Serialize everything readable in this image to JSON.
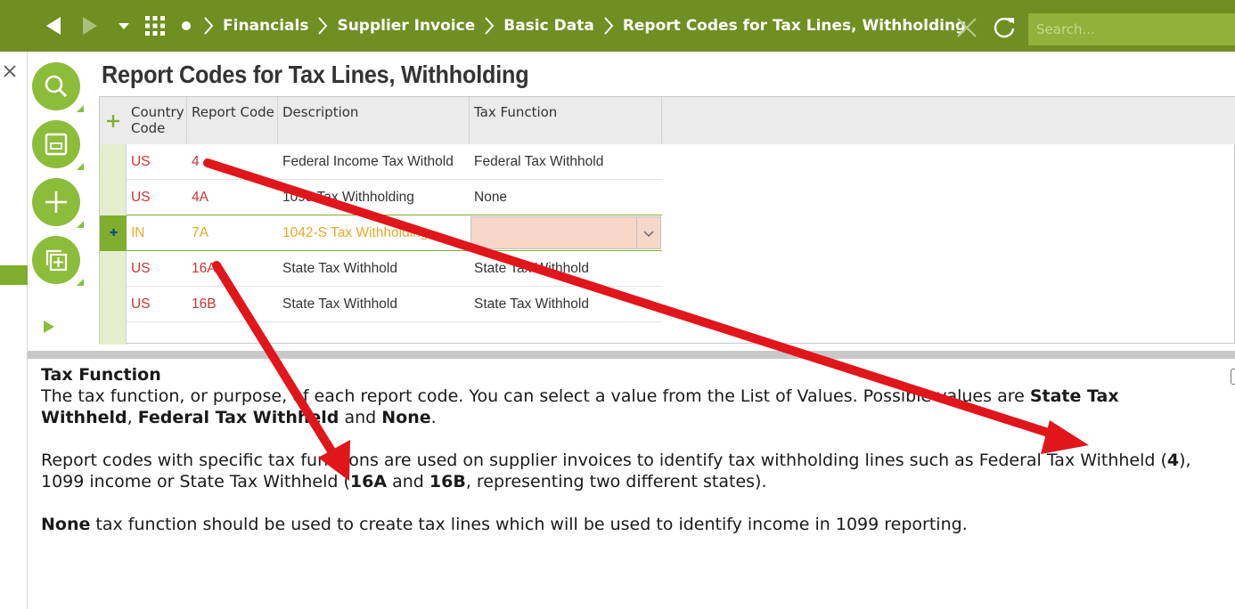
{
  "topbar": {
    "back_icon": "back-arrow-icon",
    "forward_icon": "forward-arrow-icon",
    "dropdown_icon": "history-dropdown-icon",
    "apps_icon": "apps-grid-icon",
    "home_icon": "home-dot-icon",
    "breadcrumbs": [
      "Financials",
      "Supplier Invoice",
      "Basic Data",
      "Report Codes for Tax Lines, Withholding"
    ],
    "search_placeholder": "Search..."
  },
  "page": {
    "title": "Report Codes for Tax Lines, Withholding"
  },
  "grid": {
    "columns": [
      "Country Code",
      "Report Code",
      "Description",
      "Tax Function"
    ],
    "column_lines": [
      [
        "Country",
        "Code"
      ],
      [
        "Report Code"
      ],
      [
        "Description"
      ],
      [
        "Tax Function"
      ]
    ],
    "rows": [
      {
        "country": "US",
        "report_code": "4",
        "description": "Federal Income Tax Withold",
        "tax_function": "Federal Tax Withhold"
      },
      {
        "country": "US",
        "report_code": "4A",
        "description": "1099 Tax Withholding",
        "tax_function": "None"
      },
      {
        "country": "IN",
        "report_code": "7A",
        "description": "1042-S Tax Withholding",
        "tax_function": "",
        "selected": true
      },
      {
        "country": "US",
        "report_code": "16A",
        "description": "State Tax Withhold",
        "tax_function": "State Tax Withhold"
      },
      {
        "country": "US",
        "report_code": "16B",
        "description": "State Tax Withhold",
        "tax_function": "State Tax Withhold"
      }
    ]
  },
  "help": {
    "title": "Tax Function",
    "p1_a": "The tax function, or purpose, of each report code. You can select a value from the List of Values. Possible values are ",
    "p1_b1": "State Tax Withheld",
    "p1_c": ", ",
    "p1_b2": "Federal Tax Withheld",
    "p1_d": " and ",
    "p1_b3": "None",
    "p1_e": ".",
    "p2_a": "Report codes with specific tax functions are used on supplier invoices to identify tax withholding lines such as Federal Tax Withheld (",
    "p2_b1": "4",
    "p2_c": "), 1099 income or State Tax Withheld (",
    "p2_b2": "16A",
    "p2_d": " and ",
    "p2_b3": "16B",
    "p2_e": ", representing two different states).",
    "p3_b": "None",
    "p3_a": " tax function should be used to create tax lines which will be used to identify income in 1099 reporting."
  },
  "colors": {
    "topbar": "#6f8f22",
    "accent": "#8cbd3a",
    "red_text": "#cc3333",
    "selected_text": "#e8a928",
    "annotation_arrow": "#e0161b"
  }
}
